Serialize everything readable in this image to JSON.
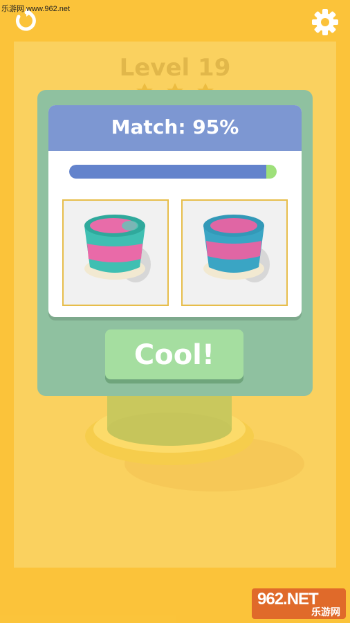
{
  "watermark": {
    "top_text": "乐游网 www.962.net",
    "brand": "962.NET",
    "brand_sub": "乐游网"
  },
  "header": {
    "level_title": "Level 19",
    "stars_count": 3
  },
  "dialog": {
    "title": "Match: 95%",
    "match_percent": 95,
    "button_label": "Cool!"
  },
  "colors": {
    "background": "#fbc23a",
    "dialog": "#8fc1a0",
    "header": "#7d97d2",
    "progress": "#6383cc",
    "button": "#a5dea0",
    "teal": "#38bfb0",
    "pink": "#ea6aa9"
  },
  "icons": {
    "restart": "restart-icon",
    "settings": "gear-icon"
  }
}
